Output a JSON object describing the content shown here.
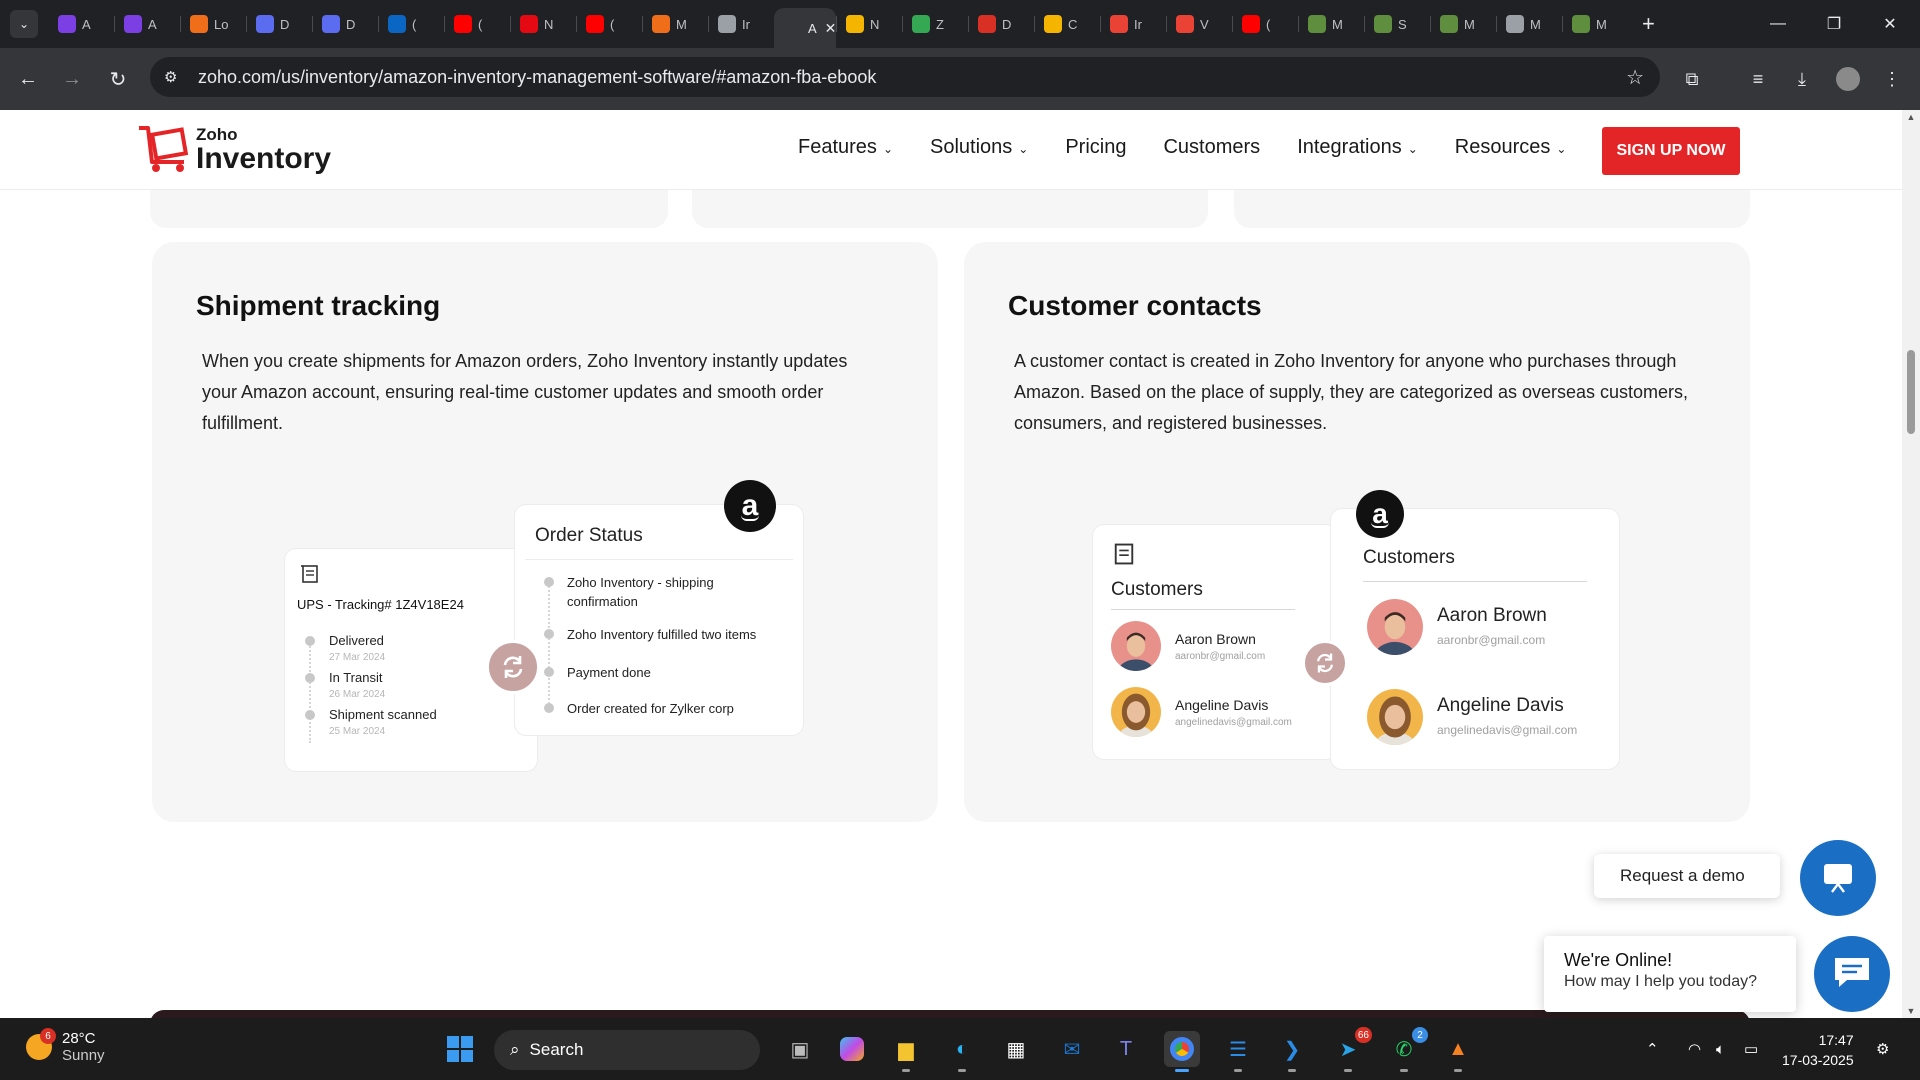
{
  "browser": {
    "tabs": [
      {
        "label": "A",
        "icon": "u-icon",
        "color": "#7b3fe4"
      },
      {
        "label": "A",
        "icon": "u-icon",
        "color": "#7b3fe4"
      },
      {
        "label": "Lo",
        "icon": "blocks-icon",
        "color": "#f06d1a"
      },
      {
        "label": "D",
        "icon": "wave-icon",
        "color": "#5b6cf0"
      },
      {
        "label": "D",
        "icon": "wave-icon",
        "color": "#5b6cf0"
      },
      {
        "label": "(",
        "icon": "linkedin-icon",
        "color": "#0a66c2"
      },
      {
        "label": "(",
        "icon": "youtube-icon",
        "color": "#ff0000"
      },
      {
        "label": "N",
        "icon": "netflix-icon",
        "color": "#e50914"
      },
      {
        "label": "(",
        "icon": "youtube-icon",
        "color": "#ff0000"
      },
      {
        "label": "M",
        "icon": "blocks-icon",
        "color": "#f06d1a"
      },
      {
        "label": "Ir",
        "icon": "globe-icon",
        "color": "#9aa0a6"
      },
      {
        "label": "A",
        "icon": "amazon-icon",
        "color": "#35363a",
        "active": true
      },
      {
        "label": "N",
        "icon": "chrome-icon",
        "color": "#f4b400"
      },
      {
        "label": "Z",
        "icon": "chrome-icon",
        "color": "#34a853"
      },
      {
        "label": "D",
        "icon": "doc-icon",
        "color": "#d93025"
      },
      {
        "label": "C",
        "icon": "box-icon",
        "color": "#f4b400"
      },
      {
        "label": "Ir",
        "icon": "gmail-icon",
        "color": "#ea4335"
      },
      {
        "label": "V",
        "icon": "gmail-icon",
        "color": "#ea4335"
      },
      {
        "label": "(",
        "icon": "youtube-icon",
        "color": "#ff0000"
      },
      {
        "label": "M",
        "icon": "shopify-icon",
        "color": "#5e8e3e"
      },
      {
        "label": "S",
        "icon": "shopify-icon",
        "color": "#5e8e3e"
      },
      {
        "label": "M",
        "icon": "shopify-icon",
        "color": "#5e8e3e"
      },
      {
        "label": "M",
        "icon": "globe-icon",
        "color": "#9aa0a6"
      },
      {
        "label": "M",
        "icon": "shopify-icon",
        "color": "#5e8e3e"
      }
    ],
    "url": "zoho.com/us/inventory/amazon-inventory-management-software/#amazon-fba-ebook"
  },
  "site": {
    "logo_top": "Zoho",
    "logo_bottom": "Inventory",
    "nav": [
      {
        "label": "Features",
        "dropdown": true
      },
      {
        "label": "Solutions",
        "dropdown": true
      },
      {
        "label": "Pricing",
        "dropdown": false
      },
      {
        "label": "Customers",
        "dropdown": false
      },
      {
        "label": "Integrations",
        "dropdown": true
      },
      {
        "label": "Resources",
        "dropdown": true
      }
    ],
    "cta": "SIGN UP NOW",
    "brand_red": "#e42527"
  },
  "shipment": {
    "title": "Shipment tracking",
    "body": "When you create shipments for Amazon orders, Zoho Inventory instantly updates your Amazon account, ensuring real-time customer updates and smooth order fulfillment.",
    "tracking_label": "UPS - Tracking# 1Z4V18E24",
    "tracking_events": [
      {
        "label": "Delivered",
        "date": "27 Mar 2024"
      },
      {
        "label": "In Transit",
        "date": "26 Mar 2024"
      },
      {
        "label": "Shipment scanned",
        "date": "25 Mar 2024"
      }
    ],
    "order_status_title": "Order Status",
    "order_events": [
      "Zoho Inventory - shipping confirmation",
      "Zoho Inventory fulfilled two items",
      "Payment done",
      "Order created for Zylker corp"
    ]
  },
  "contacts": {
    "title": "Customer contacts",
    "body": "A customer contact is created in Zoho Inventory for anyone who purchases through Amazon. Based on the place of supply, they are categorized as overseas customers, consumers, and registered businesses.",
    "left_title": "Customers",
    "right_title": "Customers",
    "customers": [
      {
        "name": "Aaron Brown",
        "email": "aaronbr@gmail.com"
      },
      {
        "name": "Angeline Davis",
        "email": "angelinedavis@gmail.com"
      }
    ]
  },
  "widgets": {
    "demo_label": "Request a demo",
    "online_title": "We're Online!",
    "online_sub": "How may I help you today?"
  },
  "taskbar": {
    "temp": "28°C",
    "weather": "Sunny",
    "weather_badge": "6",
    "search": "Search",
    "telegram_badge": "66",
    "whatsapp_badge": "2",
    "time": "17:47",
    "date": "17-03-2025"
  }
}
